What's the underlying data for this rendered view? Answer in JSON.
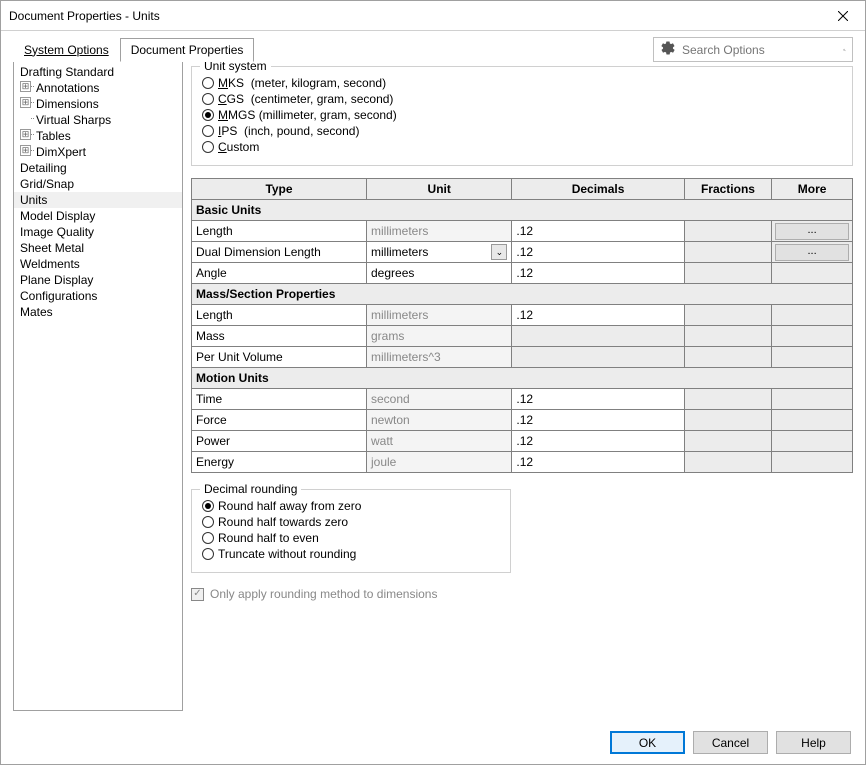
{
  "window": {
    "title": "Document Properties - Units"
  },
  "search": {
    "placeholder": "Search Options"
  },
  "tabs": {
    "system": "System Options",
    "document": "Document Properties"
  },
  "tree": {
    "root": "Drafting Standard",
    "children": [
      "Annotations",
      "Dimensions",
      "Virtual Sharps",
      "Tables",
      "DimXpert"
    ],
    "items": [
      "Detailing",
      "Grid/Snap",
      "Units",
      "Model Display",
      "Image Quality",
      "Sheet Metal",
      "Weldments",
      "Plane Display",
      "Configurations",
      "Mates"
    ]
  },
  "unitSystem": {
    "legend": "Unit system",
    "options": [
      {
        "key": "M",
        "label": "KS",
        "hint": "(meter, kilogram, second)",
        "checked": false
      },
      {
        "key": "C",
        "label": "GS",
        "hint": "(centimeter, gram, second)",
        "checked": false
      },
      {
        "key": "M",
        "label": "MGS",
        "hint": "(millimeter, gram, second)",
        "checked": true
      },
      {
        "key": "I",
        "label": "PS",
        "hint": "(inch, pound, second)",
        "checked": false
      },
      {
        "key": "C",
        "label": "ustom",
        "hint": "",
        "checked": false
      }
    ]
  },
  "tableHeaders": {
    "type": "Type",
    "unit": "Unit",
    "decimals": "Decimals",
    "fractions": "Fractions",
    "more": "More"
  },
  "sections": {
    "basic": "Basic Units",
    "mass": "Mass/Section Properties",
    "motion": "Motion Units"
  },
  "rows": {
    "length": {
      "type": "Length",
      "unit": "millimeters",
      "dec": ".12",
      "moreBtn": "..."
    },
    "dual": {
      "type": "Dual Dimension Length",
      "unit": "millimeters",
      "dec": ".12",
      "moreBtn": "..."
    },
    "angle": {
      "type": "Angle",
      "unit": "degrees",
      "dec": ".12"
    },
    "mlength": {
      "type": "Length",
      "unit": "millimeters",
      "dec": ".12"
    },
    "mass": {
      "type": "Mass",
      "unit": "grams"
    },
    "pvol": {
      "type": "Per Unit Volume",
      "unit": "millimeters^3"
    },
    "time": {
      "type": "Time",
      "unit": "second",
      "dec": ".12"
    },
    "force": {
      "type": "Force",
      "unit": "newton",
      "dec": ".12"
    },
    "power": {
      "type": "Power",
      "unit": "watt",
      "dec": ".12"
    },
    "energy": {
      "type": "Energy",
      "unit": "joule",
      "dec": ".12"
    }
  },
  "rounding": {
    "legend": "Decimal rounding",
    "options": [
      {
        "label": "Round half away from zero",
        "checked": true
      },
      {
        "label": "Round half towards zero",
        "checked": false
      },
      {
        "label": "Round half to even",
        "checked": false
      },
      {
        "label": "Truncate without rounding",
        "checked": false
      }
    ],
    "checkbox": "Only apply rounding method to dimensions"
  },
  "buttons": {
    "ok": "OK",
    "cancel": "Cancel",
    "help": "Help"
  }
}
